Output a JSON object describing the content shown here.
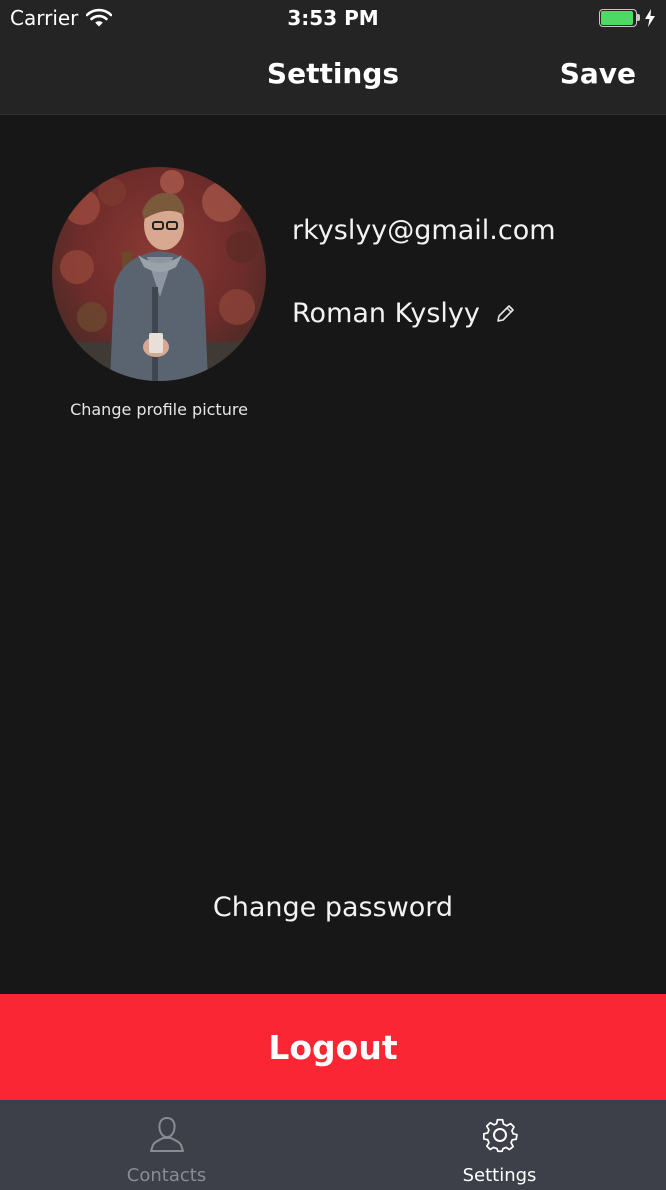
{
  "status_bar": {
    "carrier": "Carrier",
    "time": "3:53 PM",
    "battery_level": 1.0,
    "icons": [
      "wifi-icon",
      "battery-icon",
      "charging-bolt-icon"
    ]
  },
  "nav_bar": {
    "title": "Settings",
    "save_label": "Save"
  },
  "profile": {
    "change_photo_label": "Change profile picture",
    "email": "rkyslyy@gmail.com",
    "name": "Roman Kyslyy",
    "edit_icon": "pencil-icon"
  },
  "actions": {
    "change_password_label": "Change password",
    "logout_label": "Logout"
  },
  "tab_bar": {
    "tabs": [
      {
        "label": "Contacts",
        "icon": "person-icon",
        "selected": false
      },
      {
        "label": "Settings",
        "icon": "gear-icon",
        "selected": true
      }
    ]
  },
  "colors": {
    "background": "#171717",
    "bar_background": "#242424",
    "logout_red": "#fb2634",
    "tab_bar_background": "#3e4049",
    "battery_green": "#4cd964"
  }
}
